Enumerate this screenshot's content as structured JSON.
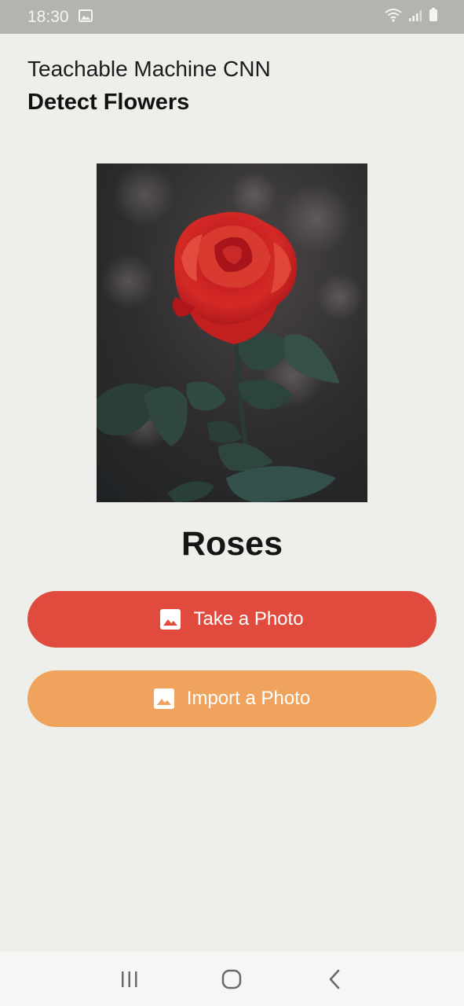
{
  "status_bar": {
    "time": "18:30",
    "icons": [
      "image-notification-icon",
      "wifi-icon",
      "signal-icon",
      "battery-icon"
    ]
  },
  "header": {
    "title": "Teachable Machine CNN",
    "subtitle": "Detect Flowers"
  },
  "photo": {
    "subject": "red rose"
  },
  "result": {
    "label": "Roses"
  },
  "buttons": {
    "take_photo": {
      "label": "Take a Photo",
      "icon": "image-icon",
      "color": "#e04b3d"
    },
    "import_photo": {
      "label": "Import a Photo",
      "icon": "image-icon",
      "color": "#f0a35d"
    }
  },
  "nav_bar": {
    "items": [
      "recent-apps-icon",
      "home-icon",
      "back-icon"
    ]
  },
  "colors": {
    "background": "#eeeeea",
    "status_bar": "#b4b4ae"
  }
}
